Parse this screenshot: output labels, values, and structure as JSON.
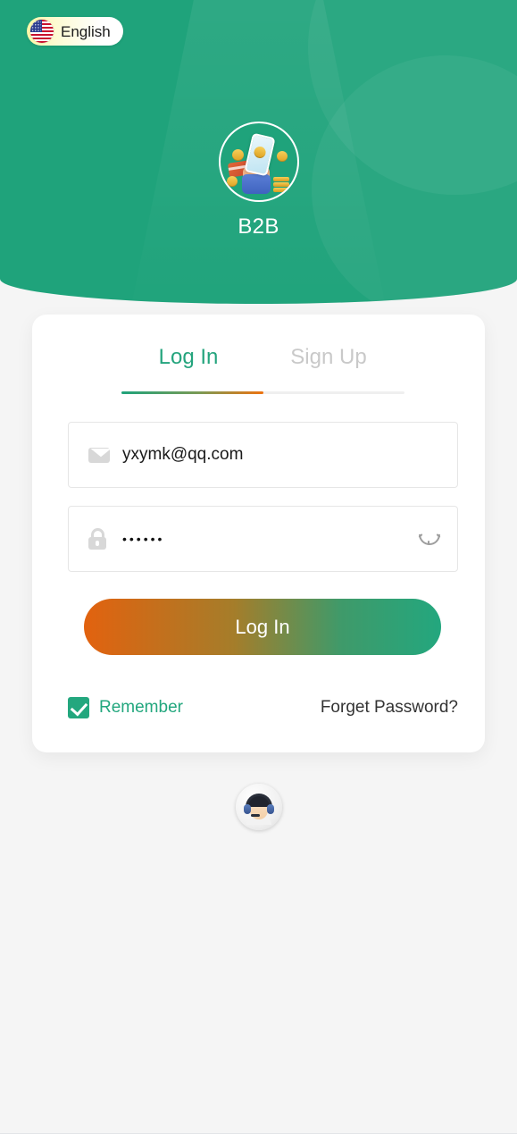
{
  "header": {
    "language_label": "English",
    "language_icon": "us-flag-icon",
    "app_title": "B2B",
    "logo_icon": "hand-holding-phone-with-coins-icon",
    "background_color": "#1fa37b"
  },
  "card": {
    "tabs": [
      {
        "label": "Log In",
        "active": true
      },
      {
        "label": "Sign Up",
        "active": false
      }
    ],
    "email_field": {
      "icon": "envelope-icon",
      "value": "yxymk@qq.com"
    },
    "password_field": {
      "icon": "lock-icon",
      "value": "••••••",
      "toggle_icon": "eye-closed-icon"
    },
    "login_button": {
      "label": "Log In",
      "gradient_from": "#e2620f",
      "gradient_to": "#23a77e"
    },
    "remember": {
      "label": "Remember",
      "checked": true,
      "color": "#23a77e"
    },
    "forgot_password": {
      "label": "Forget Password?"
    }
  },
  "support": {
    "icon": "customer-service-agent-icon"
  }
}
